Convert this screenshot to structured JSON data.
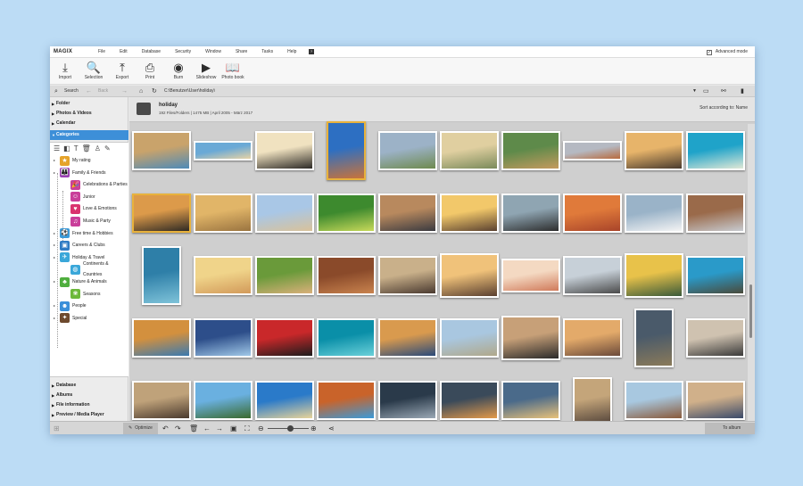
{
  "app": {
    "logo": "MAGIX"
  },
  "menu": [
    "File",
    "Edit",
    "Database",
    "Security",
    "Window",
    "Share",
    "Tasks",
    "Help"
  ],
  "help_box": "?",
  "advanced_mode": {
    "label": "Advanced mode",
    "checked": true
  },
  "toolbar": [
    {
      "label": "Import",
      "icon": "download-icon",
      "glyph": "⤓"
    },
    {
      "label": "Selection",
      "icon": "search-icon",
      "glyph": "🔍"
    },
    {
      "label": "Export",
      "icon": "upload-icon",
      "glyph": "⤒"
    },
    {
      "label": "Print",
      "icon": "printer-icon",
      "glyph": "⎙"
    },
    {
      "label": "Burn",
      "icon": "disc-icon",
      "glyph": "◉"
    },
    {
      "label": "Slideshow",
      "icon": "play-icon",
      "glyph": "▶"
    },
    {
      "label": "Photo book",
      "icon": "book-icon",
      "glyph": "📖"
    }
  ],
  "nav": {
    "search_label": "Search",
    "back_label": "Back",
    "path": "C:\\Benutzer\\User\\holiday\\"
  },
  "sidebar": {
    "top_sections": [
      "Folder",
      "Photos & Videos",
      "Calendar",
      "Categories"
    ],
    "bottom_sections": [
      "Database",
      "Albums",
      "File information",
      "Preview / Media Player"
    ],
    "tree": [
      {
        "label": "My rating",
        "level": 0,
        "color": "#e5a32a",
        "icon": "star-icon",
        "glyph": "★"
      },
      {
        "label": "Family & Friends",
        "level": 0,
        "color": "#9b3fb5",
        "icon": "people-icon",
        "glyph": "👪"
      },
      {
        "label": "Celebrations & Parties",
        "level": 1,
        "color": "#c93f9a",
        "icon": "party-icon",
        "glyph": "🎉"
      },
      {
        "label": "Junior",
        "level": 1,
        "color": "#c93f9a",
        "icon": "child-icon",
        "glyph": "☺"
      },
      {
        "label": "Love & Emotions",
        "level": 1,
        "color": "#d9336f",
        "icon": "heart-icon",
        "glyph": "♥"
      },
      {
        "label": "Music & Party",
        "level": 1,
        "color": "#c93f9a",
        "icon": "music-icon",
        "glyph": "♫"
      },
      {
        "label": "Free time & Hobbies",
        "level": 0,
        "color": "#3a9ad9",
        "icon": "hobby-icon",
        "glyph": "⚽"
      },
      {
        "label": "Careers & Clubs",
        "level": 0,
        "color": "#2f7bc4",
        "icon": "briefcase-icon",
        "glyph": "▣"
      },
      {
        "label": "Holiday & Travel",
        "level": 0,
        "color": "#3aa7d9",
        "icon": "palm-icon",
        "glyph": "✈"
      },
      {
        "label": "Continents & Countries",
        "level": 1,
        "color": "#3aa7d9",
        "icon": "globe-icon",
        "glyph": "◍"
      },
      {
        "label": "Nature & Animals",
        "level": 0,
        "color": "#4fae3e",
        "icon": "tree-icon",
        "glyph": "♣"
      },
      {
        "label": "Seasons",
        "level": 1,
        "color": "#6cb83a",
        "icon": "leaf-icon",
        "glyph": "❀"
      },
      {
        "label": "People",
        "level": 0,
        "color": "#3a8fd9",
        "icon": "person-icon",
        "glyph": "☻"
      },
      {
        "label": "Special",
        "level": 0,
        "color": "#6e4a2e",
        "icon": "special-icon",
        "glyph": "✦"
      }
    ]
  },
  "folder": {
    "name": "holiday",
    "info": "192 Files/Folders | 1475 MB | April 2005 - März 2017",
    "sort_label": "Sort according to: Name"
  },
  "bottom": {
    "optimize_label": "Optimize",
    "to_album_label": "To album"
  },
  "photo_rows": [
    [
      {
        "c1": "#c9a36b",
        "c2": "#4d8ab8"
      },
      {
        "c1": "#6aa9d6",
        "c2": "#e7d3a6"
      },
      {
        "c1": "#f0e2c0",
        "c2": "#2d2a26"
      },
      {
        "c1": "#2d6fc2",
        "c2": "#c9733a"
      },
      {
        "c1": "#9cb2c7",
        "c2": "#6e8a4e"
      },
      {
        "c1": "#e0cfa0",
        "c2": "#7a8a5a"
      },
      {
        "c1": "#5e8a4a",
        "c2": "#c49a5e"
      },
      {
        "c1": "#b5b9c2",
        "c2": "#b86a3d"
      },
      {
        "c1": "#e7b46a",
        "c2": "#4a3b2e"
      },
      {
        "c1": "#1fa3c9",
        "c2": "#dfe8d6"
      }
    ],
    [
      {
        "c1": "#dc9a4a",
        "c2": "#2f2a24"
      },
      {
        "c1": "#e1b568",
        "c2": "#9a7440"
      },
      {
        "c1": "#a9c7e6",
        "c2": "#d9c29a"
      },
      {
        "c1": "#3d8a2e",
        "c2": "#c7d95a"
      },
      {
        "c1": "#b8895e",
        "c2": "#3a3a40"
      },
      {
        "c1": "#f2c86a",
        "c2": "#5a4130"
      },
      {
        "c1": "#8fa5b2",
        "c2": "#2d2d2d"
      },
      {
        "c1": "#e07a3a",
        "c2": "#a8442a"
      },
      {
        "c1": "#9ab3c8",
        "c2": "#f4f4f4"
      },
      {
        "c1": "#9a6a4a",
        "c2": "#c7cbd0"
      }
    ],
    [
      {
        "c1": "#2e7fa8",
        "c2": "#7fc3d9"
      },
      {
        "c1": "#f0d48a",
        "c2": "#d29a5a"
      },
      {
        "c1": "#6a9a3a",
        "c2": "#d9b07a"
      },
      {
        "c1": "#8a4a2a",
        "c2": "#c9834e"
      },
      {
        "c1": "#c9b08a",
        "c2": "#4a3a30"
      },
      {
        "c1": "#f0c27a",
        "c2": "#5a4030"
      },
      {
        "c1": "#f4d9c2",
        "c2": "#d07a5a"
      },
      {
        "c1": "#c7d0d8",
        "c2": "#4a4a4a"
      },
      {
        "c1": "#e8c24a",
        "c2": "#3a5a3a"
      },
      {
        "c1": "#2a9ac9",
        "c2": "#4a4a3a"
      }
    ],
    [
      {
        "c1": "#d3903e",
        "c2": "#3a7ab0"
      },
      {
        "c1": "#2d4e8a",
        "c2": "#a0c8e8"
      },
      {
        "c1": "#c9282a",
        "c2": "#1c1c1c"
      },
      {
        "c1": "#0a8fa8",
        "c2": "#6ad0d9"
      },
      {
        "c1": "#d99a4e",
        "c2": "#2a4a7a"
      },
      {
        "c1": "#a9c7e0",
        "c2": "#b0a88a"
      },
      {
        "c1": "#c7a078",
        "c2": "#2a2a2a"
      },
      {
        "c1": "#e3aa6a",
        "c2": "#6b4a3a"
      },
      {
        "c1": "#4a5a6a",
        "c2": "#8a7a5a"
      },
      {
        "c1": "#cfc2b0",
        "c2": "#3a3a3a"
      }
    ],
    [
      {
        "c1": "#bfa27a",
        "c2": "#4a3a2e"
      },
      {
        "c1": "#6ab0e0",
        "c2": "#3a6a2e"
      },
      {
        "c1": "#2a7ac9",
        "c2": "#e8d49a"
      },
      {
        "c1": "#c9632a",
        "c2": "#3a9ad9"
      },
      {
        "c1": "#2a3a4a",
        "c2": "#9aa8b5"
      },
      {
        "c1": "#3a4a5a",
        "c2": "#e39a4a"
      },
      {
        "c1": "#4a6a8a",
        "c2": "#e8c27a"
      },
      {
        "c1": "#c4a57a",
        "c2": "#5a4a3e"
      },
      {
        "c1": "#a8c8e0",
        "c2": "#8a5a3a"
      },
      {
        "c1": "#d0b08a",
        "c2": "#3a4a6a"
      }
    ]
  ]
}
